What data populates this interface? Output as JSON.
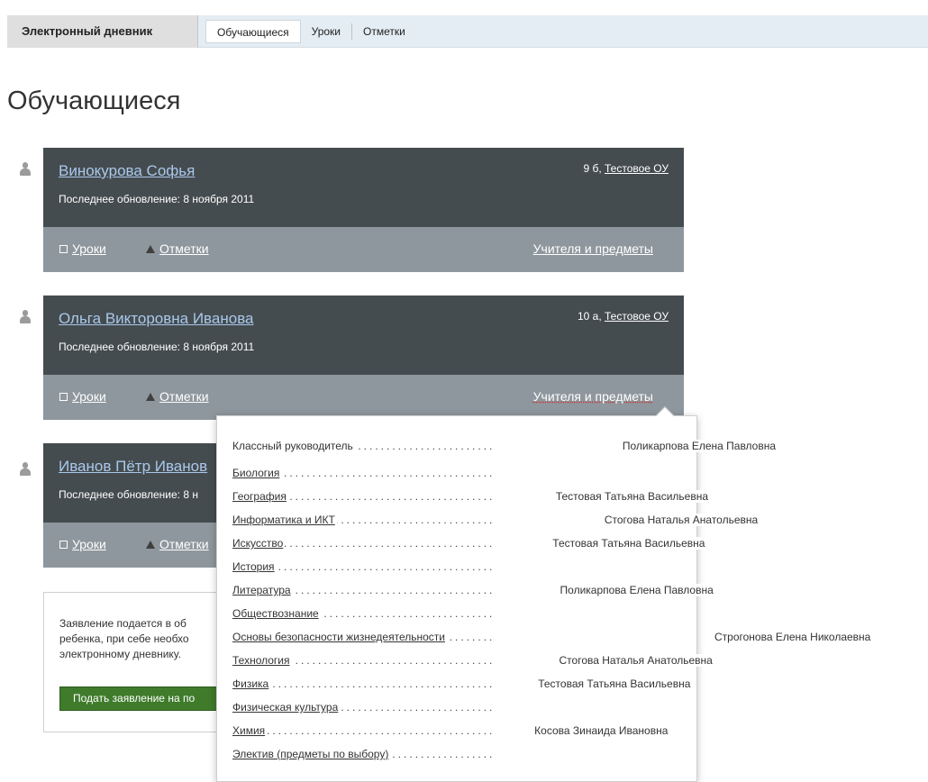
{
  "nav": {
    "brand": "Электронный дневник",
    "tabs": [
      {
        "label": "Обучающиеся",
        "active": true
      },
      {
        "label": "Уроки",
        "active": false
      },
      {
        "label": "Отметки",
        "active": false
      }
    ]
  },
  "page_title": "Обучающиеся",
  "students": [
    {
      "name": "Винокурова Софья",
      "updated": "Последнее обновление: 8 ноября 2011",
      "class": "9 б,",
      "school": "Тестовое ОУ",
      "lessons": "Уроки",
      "marks": "Отметки",
      "teachers": "Учителя и предметы"
    },
    {
      "name": "Ольга Викторовна Иванова",
      "updated": "Последнее обновление: 8 ноября 2011",
      "class": "10 а,",
      "school": "Тестовое ОУ",
      "lessons": "Уроки",
      "marks": "Отметки",
      "teachers": "Учителя и предметы"
    },
    {
      "name": "Иванов Пётр Иванов",
      "updated": "Последнее обновление: 8 н",
      "class": "",
      "school": "",
      "lessons": "Уроки",
      "marks": "Отметки",
      "teachers": ""
    }
  ],
  "info": {
    "lines": [
      "Заявление подается в об",
      "ребенка, при себе необхо",
      "электронному дневнику."
    ],
    "button": "Подать заявление на по"
  },
  "popup": {
    "rows": [
      {
        "subject": "Классный руководитель",
        "teacher": "Поликарпова Елена Павловна",
        "link": false
      },
      {
        "subject": "Биология",
        "teacher": "",
        "link": true
      },
      {
        "subject": "География",
        "teacher": "Тестовая Татьяна Васильевна",
        "link": true
      },
      {
        "subject": "Информатика и ИКТ",
        "teacher": "Стогова Наталья Анатольевна",
        "link": true
      },
      {
        "subject": "Искусство",
        "teacher": "Тестовая Татьяна Васильевна",
        "link": true
      },
      {
        "subject": "История",
        "teacher": "",
        "link": true
      },
      {
        "subject": "Литература",
        "teacher": "Поликарпова Елена Павловна",
        "link": true
      },
      {
        "subject": "Обществознание",
        "teacher": "",
        "link": true
      },
      {
        "subject": "Основы безопасности жизнедеятельности",
        "teacher": "Строгонова Елена Николаевна",
        "link": true
      },
      {
        "subject": "Технология",
        "teacher": "Стогова Наталья Анатольевна",
        "link": true
      },
      {
        "subject": "Физика",
        "teacher": "Тестовая Татьяна Васильевна",
        "link": true
      },
      {
        "subject": "Физическая культура",
        "teacher": "",
        "link": true
      },
      {
        "subject": "Химия",
        "teacher": "Косова Зинаида Ивановна",
        "link": true
      },
      {
        "subject": "Электив (предметы по выбору)",
        "teacher": "",
        "link": true
      }
    ]
  }
}
